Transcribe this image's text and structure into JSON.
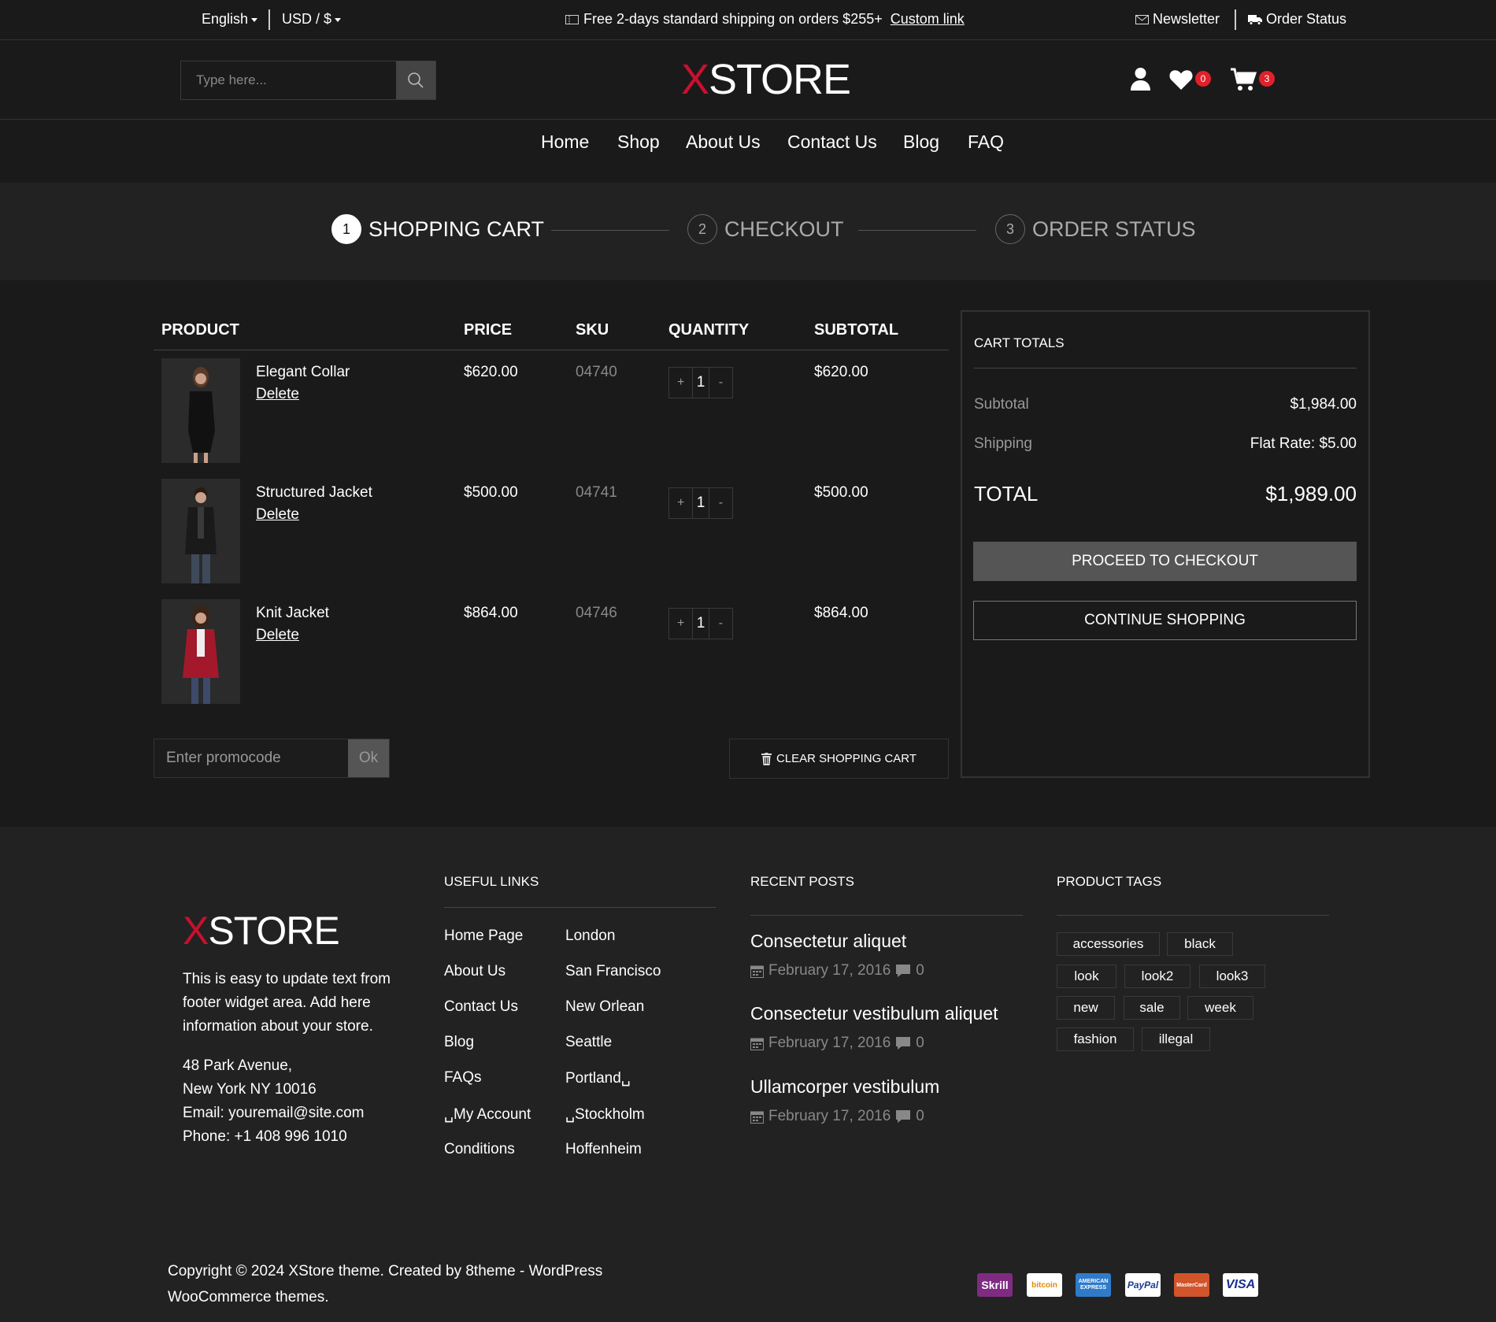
{
  "topbar": {
    "language": "English",
    "currency": "USD / $",
    "shipping_text": "Free 2-days standard shipping on orders $255+",
    "custom_link": "Custom link",
    "newsletter": "Newsletter",
    "order_status": "Order Status"
  },
  "header": {
    "search_placeholder": "Type here...",
    "logo_x": "X",
    "logo_rest": "STORE",
    "wishlist_count": "0",
    "cart_count": "3"
  },
  "nav": [
    "Home",
    "Shop",
    "About Us",
    "Contact Us",
    "Blog",
    "FAQ"
  ],
  "steps": [
    {
      "num": "1",
      "label": "SHOPPING CART"
    },
    {
      "num": "2",
      "label": "CHECKOUT"
    },
    {
      "num": "3",
      "label": "ORDER STATUS"
    }
  ],
  "cart": {
    "headers": {
      "product": "PRODUCT",
      "price": "PRICE",
      "sku": "SKU",
      "quantity": "QUANTITY",
      "subtotal": "SUBTOTAL"
    },
    "delete_label": "Delete",
    "items": [
      {
        "name": "Elegant Collar",
        "price": "$620.00",
        "sku": "04740",
        "qty": "1",
        "subtotal": "$620.00"
      },
      {
        "name": "Structured Jacket",
        "price": "$500.00",
        "sku": "04741",
        "qty": "1",
        "subtotal": "$500.00"
      },
      {
        "name": "Knit Jacket",
        "price": "$864.00",
        "sku": "04746",
        "qty": "1",
        "subtotal": "$864.00"
      }
    ],
    "plus": "+",
    "minus": "-",
    "promo_placeholder": "Enter promocode",
    "promo_ok": "Ok",
    "clear_label": "CLEAR SHOPPING CART"
  },
  "totals": {
    "title": "CART TOTALS",
    "subtotal_label": "Subtotal",
    "subtotal_value": "$1,984.00",
    "shipping_label": "Shipping",
    "shipping_value": "Flat Rate: $5.00",
    "total_label": "TOTAL",
    "total_value": "$1,989.00",
    "checkout_label": "PROCEED TO CHECKOUT",
    "continue_label": "CONTINUE SHOPPING"
  },
  "footer": {
    "logo_x": "X",
    "logo_rest": "STORE",
    "about_lines": [
      "This is easy to update text from",
      "footer widget area. Add here",
      "information about your store."
    ],
    "address_lines": [
      "48 Park Avenue,",
      "New York NY 10016",
      "Email: youremail@site.com",
      "Phone: +1 408 996 1010"
    ],
    "useful_links_title": "USEFUL LINKS",
    "links_col1": [
      "Home Page",
      "About Us",
      "Contact Us",
      "Blog",
      "FAQs",
      "␣My Account",
      "Conditions"
    ],
    "links_col2": [
      "London",
      "San Francisco",
      "New Orlean",
      "Seattle",
      "Portland␣",
      "␣Stockholm",
      "Hoffenheim"
    ],
    "recent_posts_title": "RECENT POSTS",
    "posts": [
      {
        "title": "Consectetur aliquet",
        "date": "February 17, 2016",
        "comments": "0"
      },
      {
        "title": "Consectetur vestibulum aliquet",
        "date": "February 17, 2016",
        "comments": "0"
      },
      {
        "title": "Ullamcorper vestibulum",
        "date": "February 17, 2016",
        "comments": "0"
      }
    ],
    "tags_title": "PRODUCT TAGS",
    "tags": [
      "accessories",
      "black",
      "look",
      "look2",
      "look3",
      "new",
      "sale",
      "week",
      "fashion",
      "illegal"
    ],
    "copyright_line1": "Copyright © 2024 XStore theme. Created by 8theme - WordPress",
    "copyright_line2": "WooCommerce themes.",
    "payments": [
      "Skrill",
      "bitcoin",
      "AMERICAN EXPRESS",
      "PayPal",
      "MasterCard",
      "VISA"
    ]
  },
  "colors": {
    "accent": "#c8102e",
    "badge": "#e0212b",
    "background": "#1a1a1a",
    "footer": "#222222"
  }
}
